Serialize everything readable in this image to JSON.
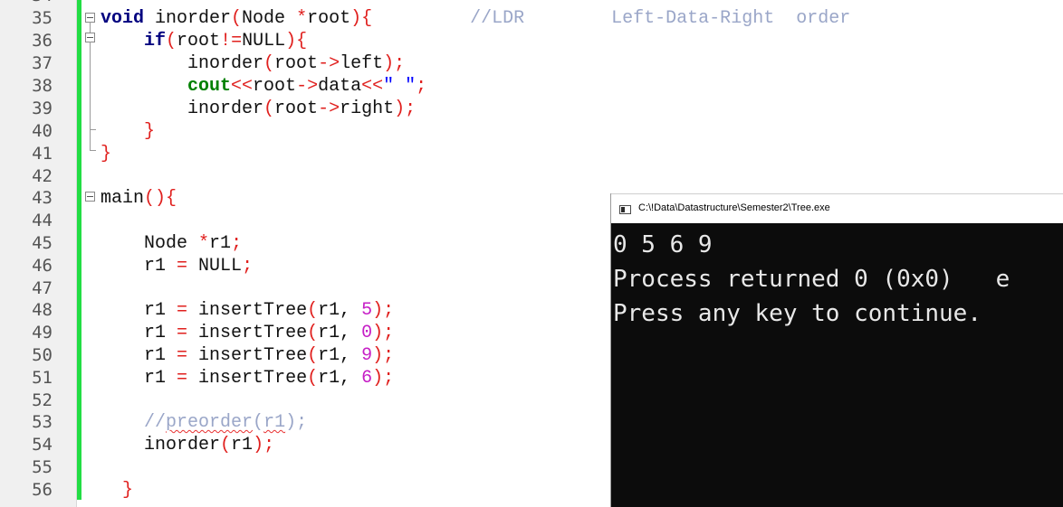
{
  "editor": {
    "line_numbers": [
      "35",
      "36",
      "37",
      "38",
      "39",
      "40",
      "41",
      "42",
      "43",
      "44",
      "45",
      "46",
      "47",
      "48",
      "49",
      "50",
      "51",
      "52",
      "53",
      "54",
      "55",
      "56"
    ],
    "code": {
      "l35": {
        "kw": "void",
        "name": " inorder",
        "p1": "(",
        "arg": "Node ",
        "star": "*",
        "argname": "root",
        "p2": "){",
        "pad": "         ",
        "cmt": "//LDR        Left-Data-Right  order"
      },
      "l36": {
        "indent": "    ",
        "kw": "if",
        "p1": "(",
        "a": "root",
        "op": "!=",
        "b": "NULL",
        "p2": "){"
      },
      "l37": {
        "indent": "        ",
        "fn": "inorder",
        "p1": "(",
        "a": "root",
        "op": "->",
        "b": "left",
        "p2": ");"
      },
      "l38": {
        "indent": "        ",
        "kw": "cout",
        "op1": "<<",
        "a": "root",
        "op2": "->",
        "b": "data",
        "op3": "<<",
        "str": "\" \"",
        "end": ";"
      },
      "l39": {
        "indent": "        ",
        "fn": "inorder",
        "p1": "(",
        "a": "root",
        "op": "->",
        "b": "right",
        "p2": ");"
      },
      "l40": {
        "indent": "    ",
        "p": "}"
      },
      "l41": {
        "p": "}"
      },
      "l43": {
        "fn": "main",
        "p": "(){"
      },
      "l45": {
        "indent": "    ",
        "a": "Node ",
        "op": "*",
        "b": "r1",
        "end": ";"
      },
      "l46": {
        "indent": "    ",
        "a": "r1 ",
        "op": "=",
        "b": " NULL",
        "end": ";"
      },
      "l48": {
        "indent": "    ",
        "a": "r1 ",
        "op": "=",
        "fn": " insertTree",
        "p1": "(",
        "arg": "r1, ",
        "num": "5",
        "p2": ");"
      },
      "l49": {
        "indent": "    ",
        "a": "r1 ",
        "op": "=",
        "fn": " insertTree",
        "p1": "(",
        "arg": "r1, ",
        "num": "0",
        "p2": ");"
      },
      "l50": {
        "indent": "    ",
        "a": "r1 ",
        "op": "=",
        "fn": " insertTree",
        "p1": "(",
        "arg": "r1, ",
        "num": "9",
        "p2": ");"
      },
      "l51": {
        "indent": "    ",
        "a": "r1 ",
        "op": "=",
        "fn": " insertTree",
        "p1": "(",
        "arg": "r1, ",
        "num": "6",
        "p2": ");"
      },
      "l53": {
        "indent": "    ",
        "cmt1": "//",
        "cmt2": "preorder",
        "cmt3": "(",
        "cmt4": "r1",
        "cmt5": ");"
      },
      "l54": {
        "indent": "    ",
        "fn": "inorder",
        "p1": "(",
        "a": "r1",
        "p2": ");"
      },
      "l56": {
        "indent": "  ",
        "p": "}"
      }
    }
  },
  "console": {
    "title": "C:\\!Data\\Datastructure\\Semester2\\Tree.exe",
    "lines": [
      "0 5 6 9",
      "Process returned 0 (0x0)   e",
      "Press any key to continue."
    ]
  },
  "colors": {
    "keyword": "#00007f",
    "cout_keyword": "#008000",
    "operator": "#e0201e",
    "number": "#c61ec6",
    "comment": "#9aa6c8",
    "string": "#0000ff",
    "change_bar": "#22dd44",
    "console_bg": "#0c0c0c"
  }
}
